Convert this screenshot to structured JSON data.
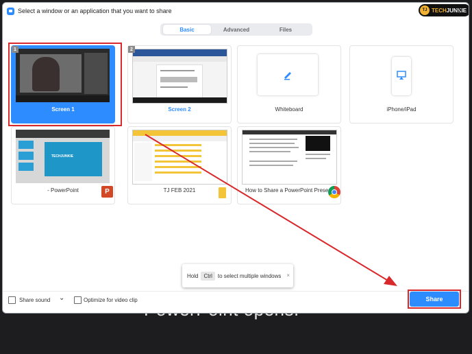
{
  "dialog": {
    "title": "Select a window or an application that you want to share",
    "brand": {
      "prefix": "TECH",
      "suffix": "JUNKIE",
      "initials": "TJ"
    },
    "close_glyph": "✕"
  },
  "tabs": [
    {
      "label": "Basic",
      "active": true
    },
    {
      "label": "Advanced",
      "active": false
    },
    {
      "label": "Files",
      "active": false
    }
  ],
  "tiles": [
    {
      "label": "Screen 1",
      "badge": "1",
      "selected": true
    },
    {
      "label": "Screen 2",
      "badge": "2",
      "selected": false
    },
    {
      "label": "Whiteboard",
      "icon": "pencil-icon"
    },
    {
      "label": "iPhone/iPad",
      "icon": "airplay-icon"
    },
    {
      "label": "- PowerPoint",
      "app_icon": "powerpoint-icon",
      "thumb_text": "TECHJUNKIE"
    },
    {
      "label": "TJ FEB 2021",
      "app_icon": "folder-icon"
    },
    {
      "label": "How to Share a PowerPoint Prese...",
      "app_icon": "chrome-icon"
    }
  ],
  "tooltip": {
    "prefix": "Hold",
    "key": "Ctrl",
    "suffix": "to select multiple windows",
    "close_glyph": "×"
  },
  "footer": {
    "share_sound_label": "Share sound",
    "share_sound_chevron": "⌄",
    "optimize_label": "Optimize for video clip",
    "share_button_label": "Share"
  },
  "background_text": "PowerPoint opens.",
  "colors": {
    "accent": "#2d8cff",
    "annotation_red": "#d9282c"
  }
}
